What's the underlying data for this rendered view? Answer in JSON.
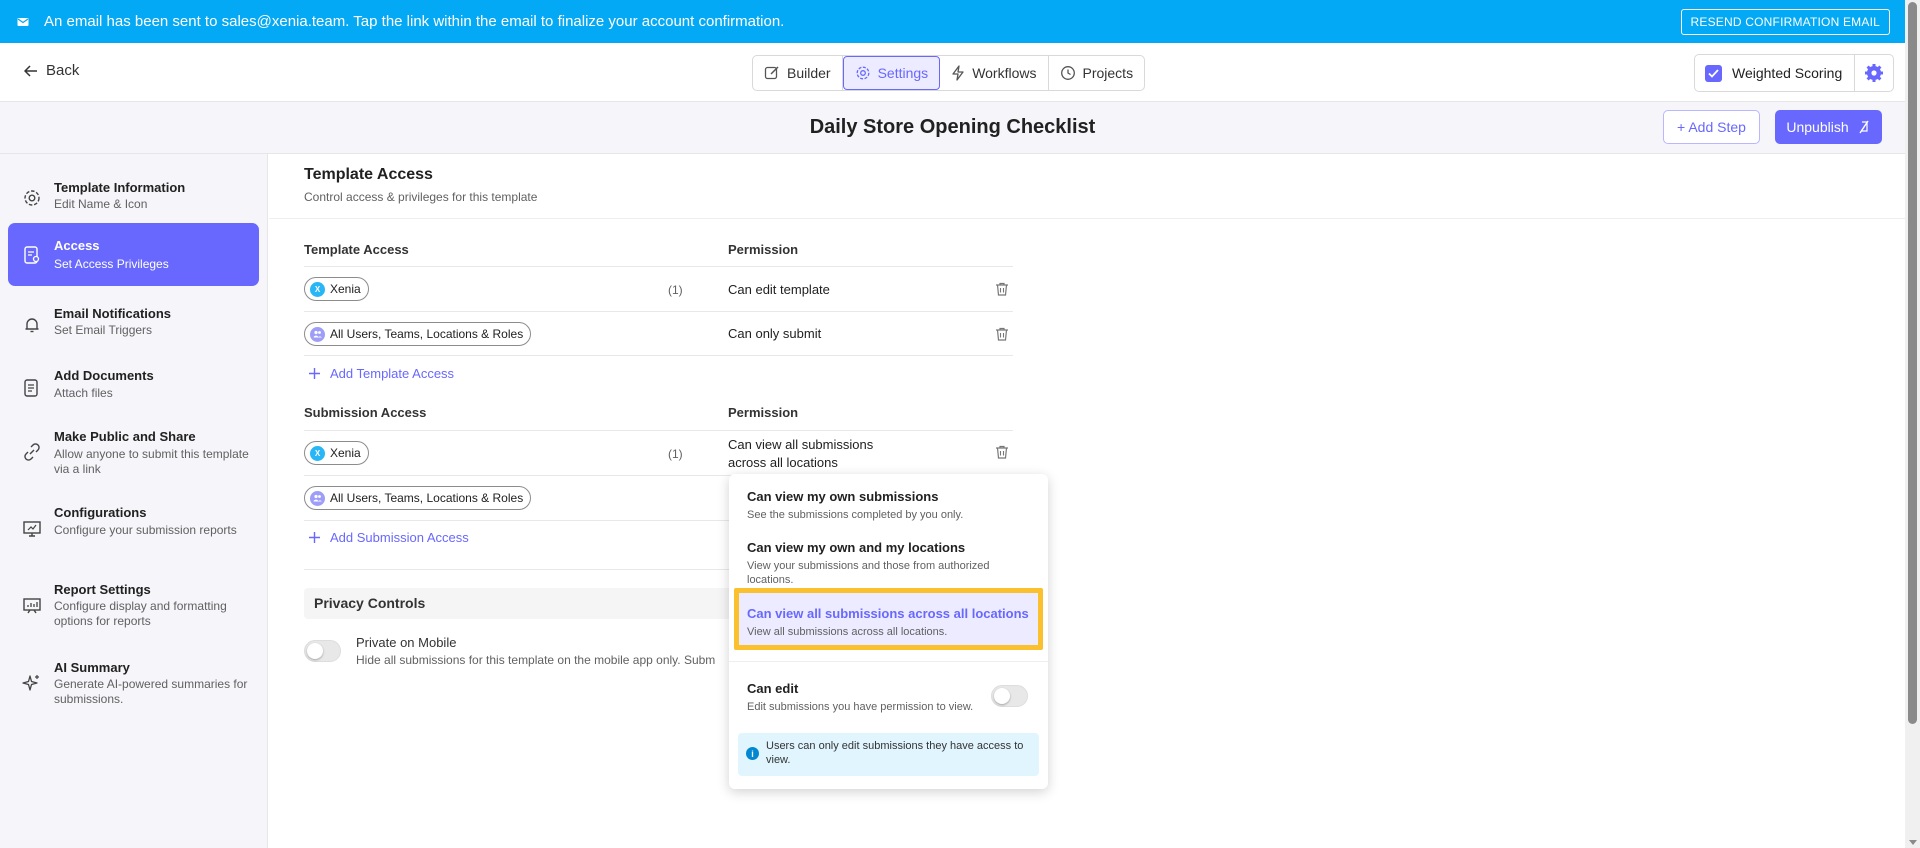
{
  "banner": {
    "message": "An email has been sent to sales@xenia.team. Tap the link within the email to finalize your account confirmation.",
    "resend_label": "RESEND CONFIRMATION EMAIL",
    "color": "#03a9f4"
  },
  "topbar": {
    "back_label": "Back",
    "tabs": [
      {
        "label": "Builder",
        "icon": "pencil-icon"
      },
      {
        "label": "Settings",
        "icon": "gear-icon",
        "active": true
      },
      {
        "label": "Workflows",
        "icon": "lightning-icon"
      },
      {
        "label": "Projects",
        "icon": "clock-icon"
      }
    ],
    "weighted_scoring_label": "Weighted Scoring",
    "weighted_scoring_checked": true
  },
  "title": {
    "text": "Daily Store Opening Checklist",
    "add_step_label": "+ Add Step",
    "unpublish_label": "Unpublish"
  },
  "sidebar": {
    "items": [
      {
        "title": "Template Information",
        "subtitle": "Edit Name & Icon",
        "icon": "gear-icon"
      },
      {
        "title": "Access",
        "subtitle": "Set Access Privileges",
        "icon": "access-document-icon",
        "active": true
      },
      {
        "title": "Email Notifications",
        "subtitle": "Set Email Triggers",
        "icon": "bell-icon"
      },
      {
        "title": "Add Documents",
        "subtitle": "Attach files",
        "icon": "document-icon"
      },
      {
        "title": "Make Public and Share",
        "subtitle": "Allow anyone to submit this template via a link",
        "icon": "link-icon"
      },
      {
        "title": "Configurations",
        "subtitle": "Configure your submission reports",
        "icon": "presentation-icon"
      },
      {
        "title": "Report Settings",
        "subtitle": "Configure display and formatting options for reports",
        "icon": "chart-board-icon"
      },
      {
        "title": "AI Summary",
        "subtitle": "Generate AI-powered summaries for submissions.",
        "icon": "sparkle-icon"
      }
    ]
  },
  "main": {
    "title": "Template Access",
    "subtitle": "Control access & privileges for this template",
    "template_access": {
      "header_left": "Template Access",
      "header_right": "Permission",
      "rows": [
        {
          "chip": "Xenia",
          "avatar": "X",
          "count": "(1)",
          "permission": "Can edit template"
        },
        {
          "chip": "All Users, Teams, Locations & Roles",
          "count": "",
          "permission": "Can only submit"
        }
      ],
      "add_label": "Add Template Access"
    },
    "submission_access": {
      "header_left": "Submission Access",
      "header_right": "Permission",
      "rows": [
        {
          "chip": "Xenia",
          "avatar": "X",
          "count": "(1)",
          "permission_line1": "Can view all submissions",
          "permission_line2": "across all locations"
        },
        {
          "chip": "All Users, Teams, Locations & Roles",
          "count": ""
        }
      ],
      "add_label": "Add Submission Access"
    },
    "privacy": {
      "title": "Privacy Controls",
      "item_title": "Private on Mobile",
      "item_subtitle": "Hide all submissions for this template on the mobile app only. Subm"
    }
  },
  "dropdown": {
    "options": [
      {
        "title": "Can view my own submissions",
        "subtitle": "See the submissions completed by you only."
      },
      {
        "title": "Can view my own and my locations",
        "subtitle": "View your submissions and those from authorized locations."
      },
      {
        "title": "Can view all submissions across all locations",
        "subtitle": "View all submissions across all locations.",
        "selected": true
      }
    ],
    "can_edit": {
      "title": "Can edit",
      "subtitle": "Edit submissions you have permission to view."
    },
    "info": "Users can only edit submissions they have access to view."
  },
  "colors": {
    "accent": "#6868fe",
    "highlight": "#fbc02d"
  }
}
